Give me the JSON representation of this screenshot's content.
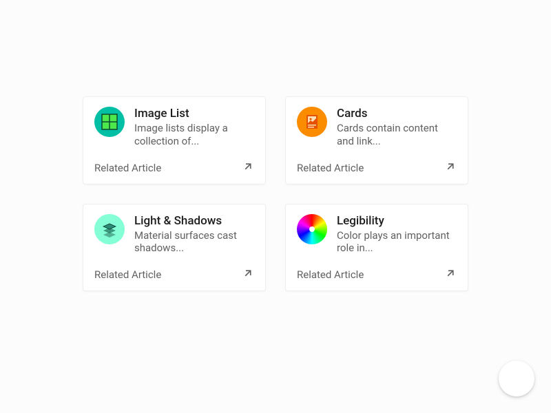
{
  "cards": [
    {
      "title": "Image List",
      "description": "Image lists display a collection of...",
      "footer_label": "Related Article",
      "icon": "grid-icon",
      "icon_bg": "#00BFA5",
      "icon_fg": "#4CE84C"
    },
    {
      "title": "Cards",
      "description": "Cards contain content and link...",
      "footer_label": "Related Article",
      "icon": "card-photo-icon",
      "icon_bg": "#FB8C00",
      "icon_fg": "#E65100"
    },
    {
      "title": "Light & Shadows",
      "description": "Material surfaces cast shadows...",
      "footer_label": "Related Article",
      "icon": "layers-icon",
      "icon_bg": "#84FFD6",
      "icon_fg": "#1E6B5A"
    },
    {
      "title": "Legibility",
      "description": "Color plays an important role in...",
      "footer_label": "Related Article",
      "icon": "color-wheel-icon",
      "icon_bg": "",
      "icon_fg": ""
    }
  ]
}
